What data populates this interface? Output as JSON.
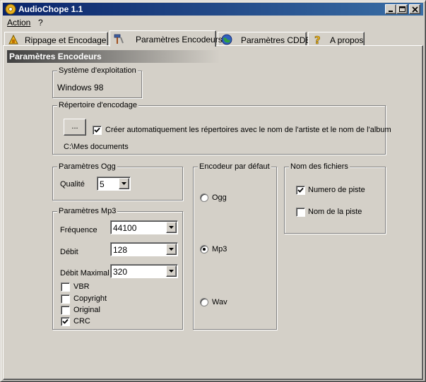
{
  "window": {
    "title": "AudioChope 1.1"
  },
  "menu": {
    "action": "Action",
    "help": "?"
  },
  "tabs": [
    {
      "label": "Rippage et Encodage",
      "icon": "rip-icon"
    },
    {
      "label": "Paramètres Encodeurs",
      "icon": "hammer-icon"
    },
    {
      "label": "Paramètres CDDB",
      "icon": "globe-icon"
    },
    {
      "label": "A propos",
      "icon": "question-icon"
    }
  ],
  "section": {
    "title": "Paramètres Encodeurs"
  },
  "os": {
    "label": "Système d'exploitation",
    "value": "Windows 98"
  },
  "encdir": {
    "label": "Répertoire d'encodage",
    "browse_label": "...",
    "auto_create_label": "Créer automatiquement les répertoires avec le nom de l'artiste et le nom de l'album",
    "auto_create_checked": true,
    "path": "C:\\Mes documents"
  },
  "ogg": {
    "label": "Paramètres Ogg",
    "quality_label": "Qualité",
    "quality_value": "5"
  },
  "mp3": {
    "label": "Paramètres Mp3",
    "frequency_label": "Fréquence",
    "frequency_value": "44100",
    "bitrate_label": "Débit",
    "bitrate_value": "128",
    "max_bitrate_label": "Débit Maximal",
    "max_bitrate_value": "320",
    "vbr_label": "VBR",
    "vbr_checked": false,
    "copyright_label": "Copyright",
    "copyright_checked": false,
    "original_label": "Original",
    "original_checked": false,
    "crc_label": "CRC",
    "crc_checked": true
  },
  "default_encoder": {
    "label": "Encodeur par défaut",
    "ogg_label": "Ogg",
    "mp3_label": "Mp3",
    "wav_label": "Wav",
    "selected": "Mp3"
  },
  "filenames": {
    "label": "Nom des fichiers",
    "track_number_label": "Numero de piste",
    "track_number_checked": true,
    "track_name_label": "Nom de la piste",
    "track_name_checked": false
  },
  "colors": {
    "titlebar_start": "#0a246a",
    "titlebar_end": "#3a6ea5",
    "face": "#d4d0c8"
  }
}
